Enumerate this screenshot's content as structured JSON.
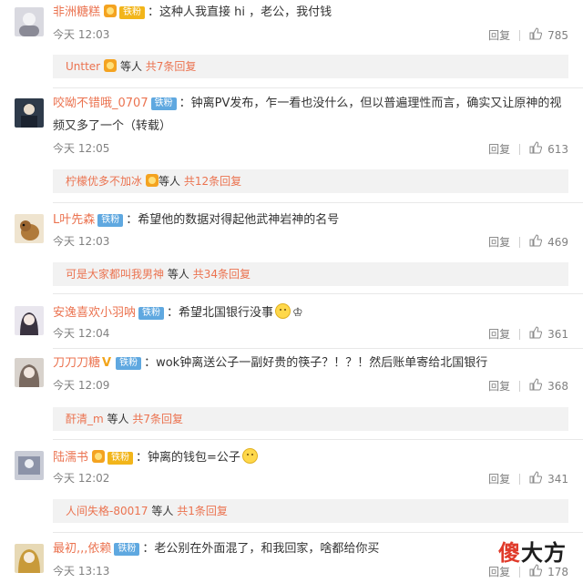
{
  "comments": [
    {
      "user": "非洲糖糕",
      "badge": "铁粉",
      "text": "这种人我直接 hi ，老公，我付钱",
      "text2": "",
      "time": "今天 12:03",
      "reply": "回复",
      "likes": "785",
      "replies": {
        "name": "Untter",
        "suffix": "等人",
        "more": "共7条回复"
      }
    },
    {
      "user": "咬呦不错哦_0707",
      "badge": "铁粉",
      "text": "钟离PV发布，乍一看也没什么，但以普遍理性而言，确实又让原神的视",
      "text2": "频又多了一个（转载）",
      "time": "今天 12:05",
      "reply": "回复",
      "likes": "613",
      "replies": {
        "name": "柠檬优多不加冰",
        "suffix": "等人",
        "more": "共12条回复"
      }
    },
    {
      "user": "L叶先森",
      "badge": "铁粉",
      "text": "希望他的数据对得起他武神岩神的名号",
      "text2": "",
      "time": "今天 12:03",
      "reply": "回复",
      "likes": "469",
      "replies": {
        "name": "可是大家都叫我男神",
        "suffix": "等人",
        "more": "共34条回复"
      }
    },
    {
      "user": "安逸喜欢小羽呐",
      "badge": "铁粉",
      "text": "希望北国银行没事",
      "text2": "",
      "time": "今天 12:04",
      "reply": "回复",
      "likes": "361"
    },
    {
      "user": "刀刀刀糖",
      "badge": "铁粉",
      "text": "wok钟离送公子一副好贵的筷子？！？！然后账单寄给北国银行",
      "text2": "",
      "time": "今天 12:09",
      "reply": "回复",
      "likes": "368",
      "replies": {
        "name": "酐清_m",
        "suffix": "等人",
        "more": "共7条回复"
      }
    },
    {
      "user": "陆濡书",
      "badge": "铁粉",
      "text": "钟离的钱包=公子",
      "text2": "",
      "time": "今天 12:02",
      "reply": "回复",
      "likes": "341",
      "replies": {
        "name": "人间失格-80017",
        "suffix": "等人",
        "more": "共1条回复"
      }
    },
    {
      "user": "最初,,,依赖",
      "badge": "铁粉",
      "text": "老公别在外面混了，和我回家，啥都给你买",
      "text2": "",
      "time": "今天 13:13",
      "reply": "回复",
      "likes": "178"
    }
  ],
  "watermark": {
    "first": "傻",
    "rest": "大方"
  },
  "colors": {
    "name": "#eb7350",
    "badge": "#5fa8e0",
    "meta": "#808080",
    "reply_bg": "#f2f2f2"
  }
}
